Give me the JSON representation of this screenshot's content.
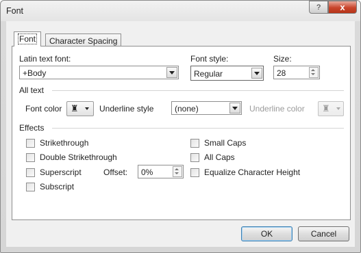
{
  "window": {
    "title": "Font",
    "help_glyph": "?",
    "close_glyph": "x"
  },
  "tabs": [
    {
      "label": "Font",
      "active": true
    },
    {
      "label": "Character Spacing",
      "active": false
    }
  ],
  "latin_font": {
    "label": "Latin text font:",
    "value": "+Body"
  },
  "font_style": {
    "label": "Font style:",
    "value": "Regular"
  },
  "size": {
    "label": "Size:",
    "value": "28"
  },
  "all_text": {
    "heading": "All text",
    "font_color_label": "Font color",
    "underline_style_label": "Underline style",
    "underline_style_value": "(none)",
    "underline_color_label": "Underline color",
    "color_icon": "paint-bucket-icon"
  },
  "effects": {
    "heading": "Effects",
    "left": [
      {
        "label": "Strikethrough",
        "checked": false
      },
      {
        "label": "Double Strikethrough",
        "checked": false
      },
      {
        "label": "Superscript",
        "checked": false
      },
      {
        "label": "Subscript",
        "checked": false
      }
    ],
    "right": [
      {
        "label": "Small Caps",
        "checked": false
      },
      {
        "label": "All Caps",
        "checked": false
      },
      {
        "label": "Equalize Character Height",
        "checked": false
      }
    ],
    "offset_label": "Offset:",
    "offset_value": "0%"
  },
  "buttons": {
    "ok": "OK",
    "cancel": "Cancel"
  }
}
